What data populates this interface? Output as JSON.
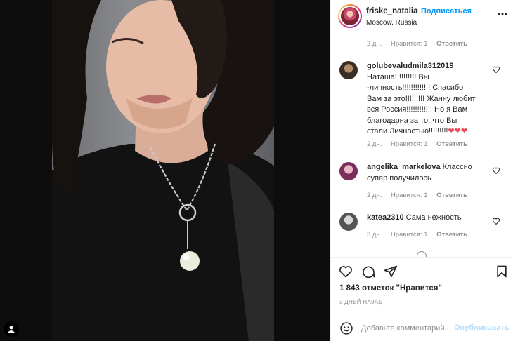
{
  "header": {
    "username": "friske_natalia",
    "dot": "•",
    "follow_label": "Подписаться",
    "location": "Moscow, Russia"
  },
  "top_meta": {
    "time": "2 дн.",
    "likes": "Нравится: 1",
    "reply": "Ответить"
  },
  "comments": [
    {
      "user": "golubevaludmila312019",
      "text": "Наташа!!!!!!!!!! Вы -личность!!!!!!!!!!!!! Спасибо Вам за это!!!!!!!!! Жанну любит вся Россия!!!!!!!!!!!! Но я Вам благодарна за то, что Вы стали Личностью!!!!!!!!!",
      "emoji": "❤❤❤",
      "time": "2 дн.",
      "likes": "Нравится: 1",
      "reply": "Ответить"
    },
    {
      "user": "angelika_markelova",
      "text": "Классно супер получилось",
      "time": "2 дн.",
      "likes": "Нравится: 1",
      "reply": "Ответить"
    },
    {
      "user": "katea2310",
      "text": "Сама нежность",
      "time": "3 дн.",
      "likes": "Нравится: 1",
      "reply": "Ответить"
    }
  ],
  "post": {
    "likes_text": "1 843 отметок \"Нравится\"",
    "date": "3 ДНЕЙ НАЗАД"
  },
  "comment_box": {
    "placeholder": "Добавьте комментарий...",
    "publish_label": "Опубликовать"
  },
  "icons": {
    "more": "ellipsis-icon",
    "like": "heart-icon",
    "comment": "comment-icon",
    "share": "send-icon",
    "save": "bookmark-icon",
    "emoji": "smiley-icon",
    "tag": "user-tag-icon"
  },
  "colors": {
    "accent": "#0095f6",
    "muted": "#8e8e8e",
    "text": "#262626",
    "heart": "#ed4956"
  }
}
